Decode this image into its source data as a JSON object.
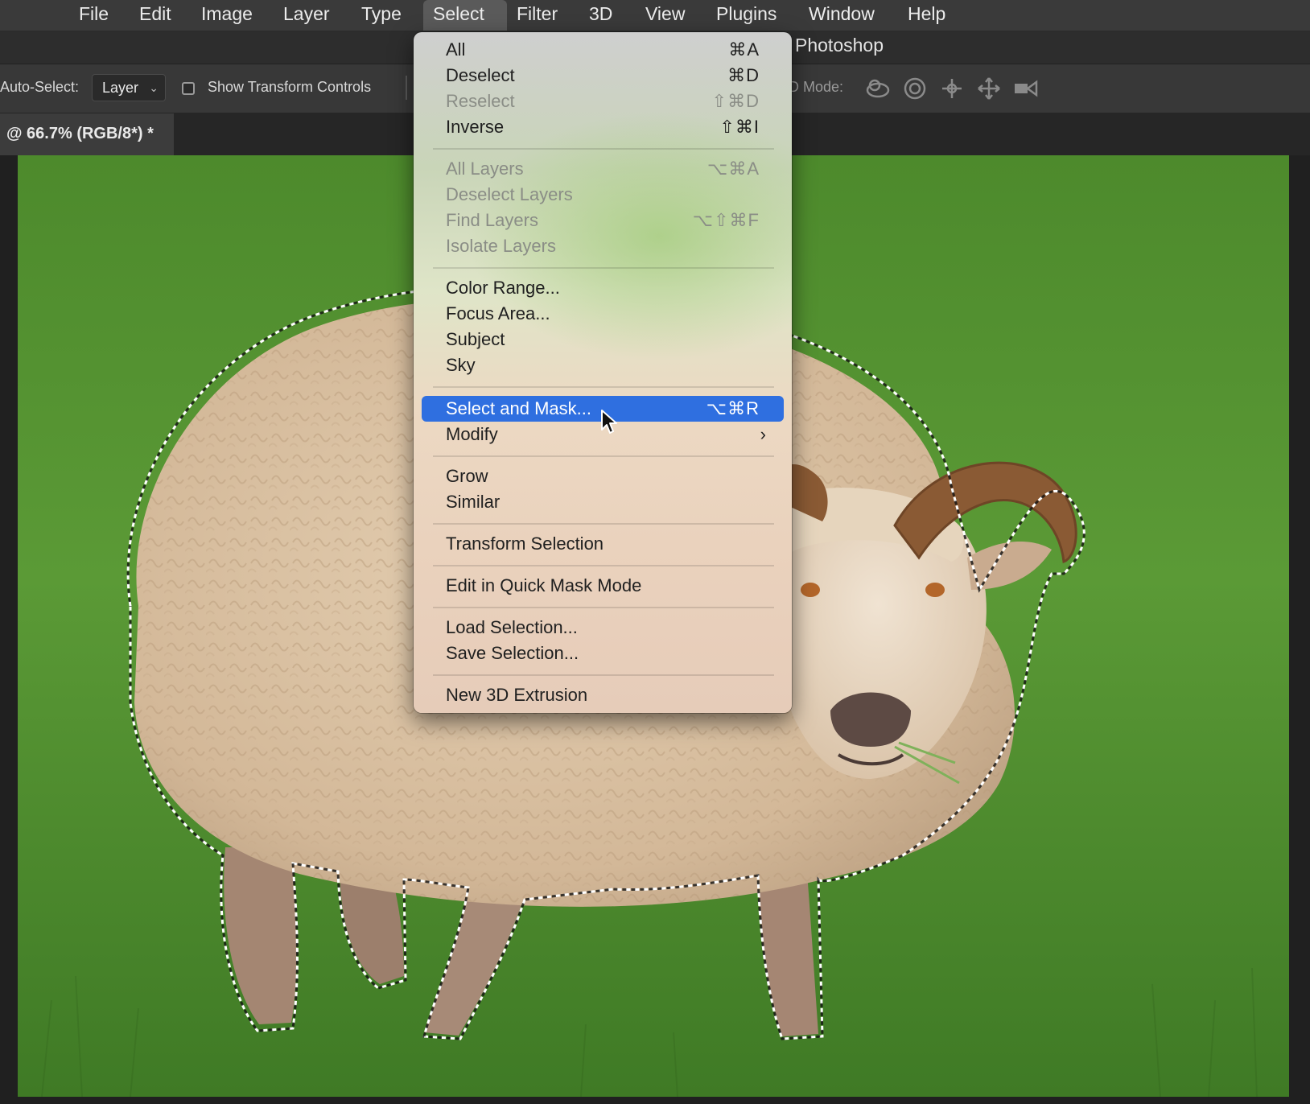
{
  "menubar": {
    "items": [
      {
        "label": "File"
      },
      {
        "label": "Edit"
      },
      {
        "label": "Image"
      },
      {
        "label": "Layer"
      },
      {
        "label": "Type"
      },
      {
        "label": "Select",
        "active": true
      },
      {
        "label": "Filter"
      },
      {
        "label": "3D"
      },
      {
        "label": "View"
      },
      {
        "label": "Plugins"
      },
      {
        "label": "Window"
      },
      {
        "label": "Help"
      }
    ]
  },
  "app_title": "Photoshop",
  "options_bar": {
    "auto_select_label": "Auto-Select:",
    "auto_select_value": "Layer",
    "show_transform_label": "Show Transform Controls",
    "mode_label": "D Mode:",
    "mode_icons": [
      "orbit-3d-icon",
      "roll-3d-icon",
      "pan-3d-icon",
      "slide-3d-icon",
      "scale-3d-icon"
    ]
  },
  "document_tab": {
    "title": "@ 66.7% (RGB/8*) *"
  },
  "select_menu": {
    "groups": [
      [
        {
          "label": "All",
          "shortcut": "⌘A",
          "enabled": true
        },
        {
          "label": "Deselect",
          "shortcut": "⌘D",
          "enabled": true
        },
        {
          "label": "Reselect",
          "shortcut": "⇧⌘D",
          "enabled": false
        },
        {
          "label": "Inverse",
          "shortcut": "⇧⌘I",
          "enabled": true
        }
      ],
      [
        {
          "label": "All Layers",
          "shortcut": "⌥⌘A",
          "enabled": false
        },
        {
          "label": "Deselect Layers",
          "shortcut": "",
          "enabled": false
        },
        {
          "label": "Find Layers",
          "shortcut": "⌥⇧⌘F",
          "enabled": false
        },
        {
          "label": "Isolate Layers",
          "shortcut": "",
          "enabled": false
        }
      ],
      [
        {
          "label": "Color Range...",
          "shortcut": "",
          "enabled": true
        },
        {
          "label": "Focus Area...",
          "shortcut": "",
          "enabled": true
        },
        {
          "label": "Subject",
          "shortcut": "",
          "enabled": true
        },
        {
          "label": "Sky",
          "shortcut": "",
          "enabled": true
        }
      ],
      [
        {
          "label": "Select and Mask...",
          "shortcut": "⌥⌘R",
          "enabled": true,
          "highlighted": true
        },
        {
          "label": "Modify",
          "shortcut": "",
          "enabled": true,
          "submenu": true
        }
      ],
      [
        {
          "label": "Grow",
          "shortcut": "",
          "enabled": true
        },
        {
          "label": "Similar",
          "shortcut": "",
          "enabled": true
        }
      ],
      [
        {
          "label": "Transform Selection",
          "shortcut": "",
          "enabled": true
        }
      ],
      [
        {
          "label": "Edit in Quick Mask Mode",
          "shortcut": "",
          "enabled": true
        }
      ],
      [
        {
          "label": "Load Selection...",
          "shortcut": "",
          "enabled": true
        },
        {
          "label": "Save Selection...",
          "shortcut": "",
          "enabled": true
        }
      ],
      [
        {
          "label": "New 3D Extrusion",
          "shortcut": "",
          "enabled": true
        }
      ]
    ],
    "highlight_color": "#2f6fe0"
  },
  "colors": {
    "menubar_bg": "#3a3a3a",
    "grass_green": "#4f8a2e",
    "wool": "#d9c3a4",
    "horn": "#8a5a34"
  }
}
